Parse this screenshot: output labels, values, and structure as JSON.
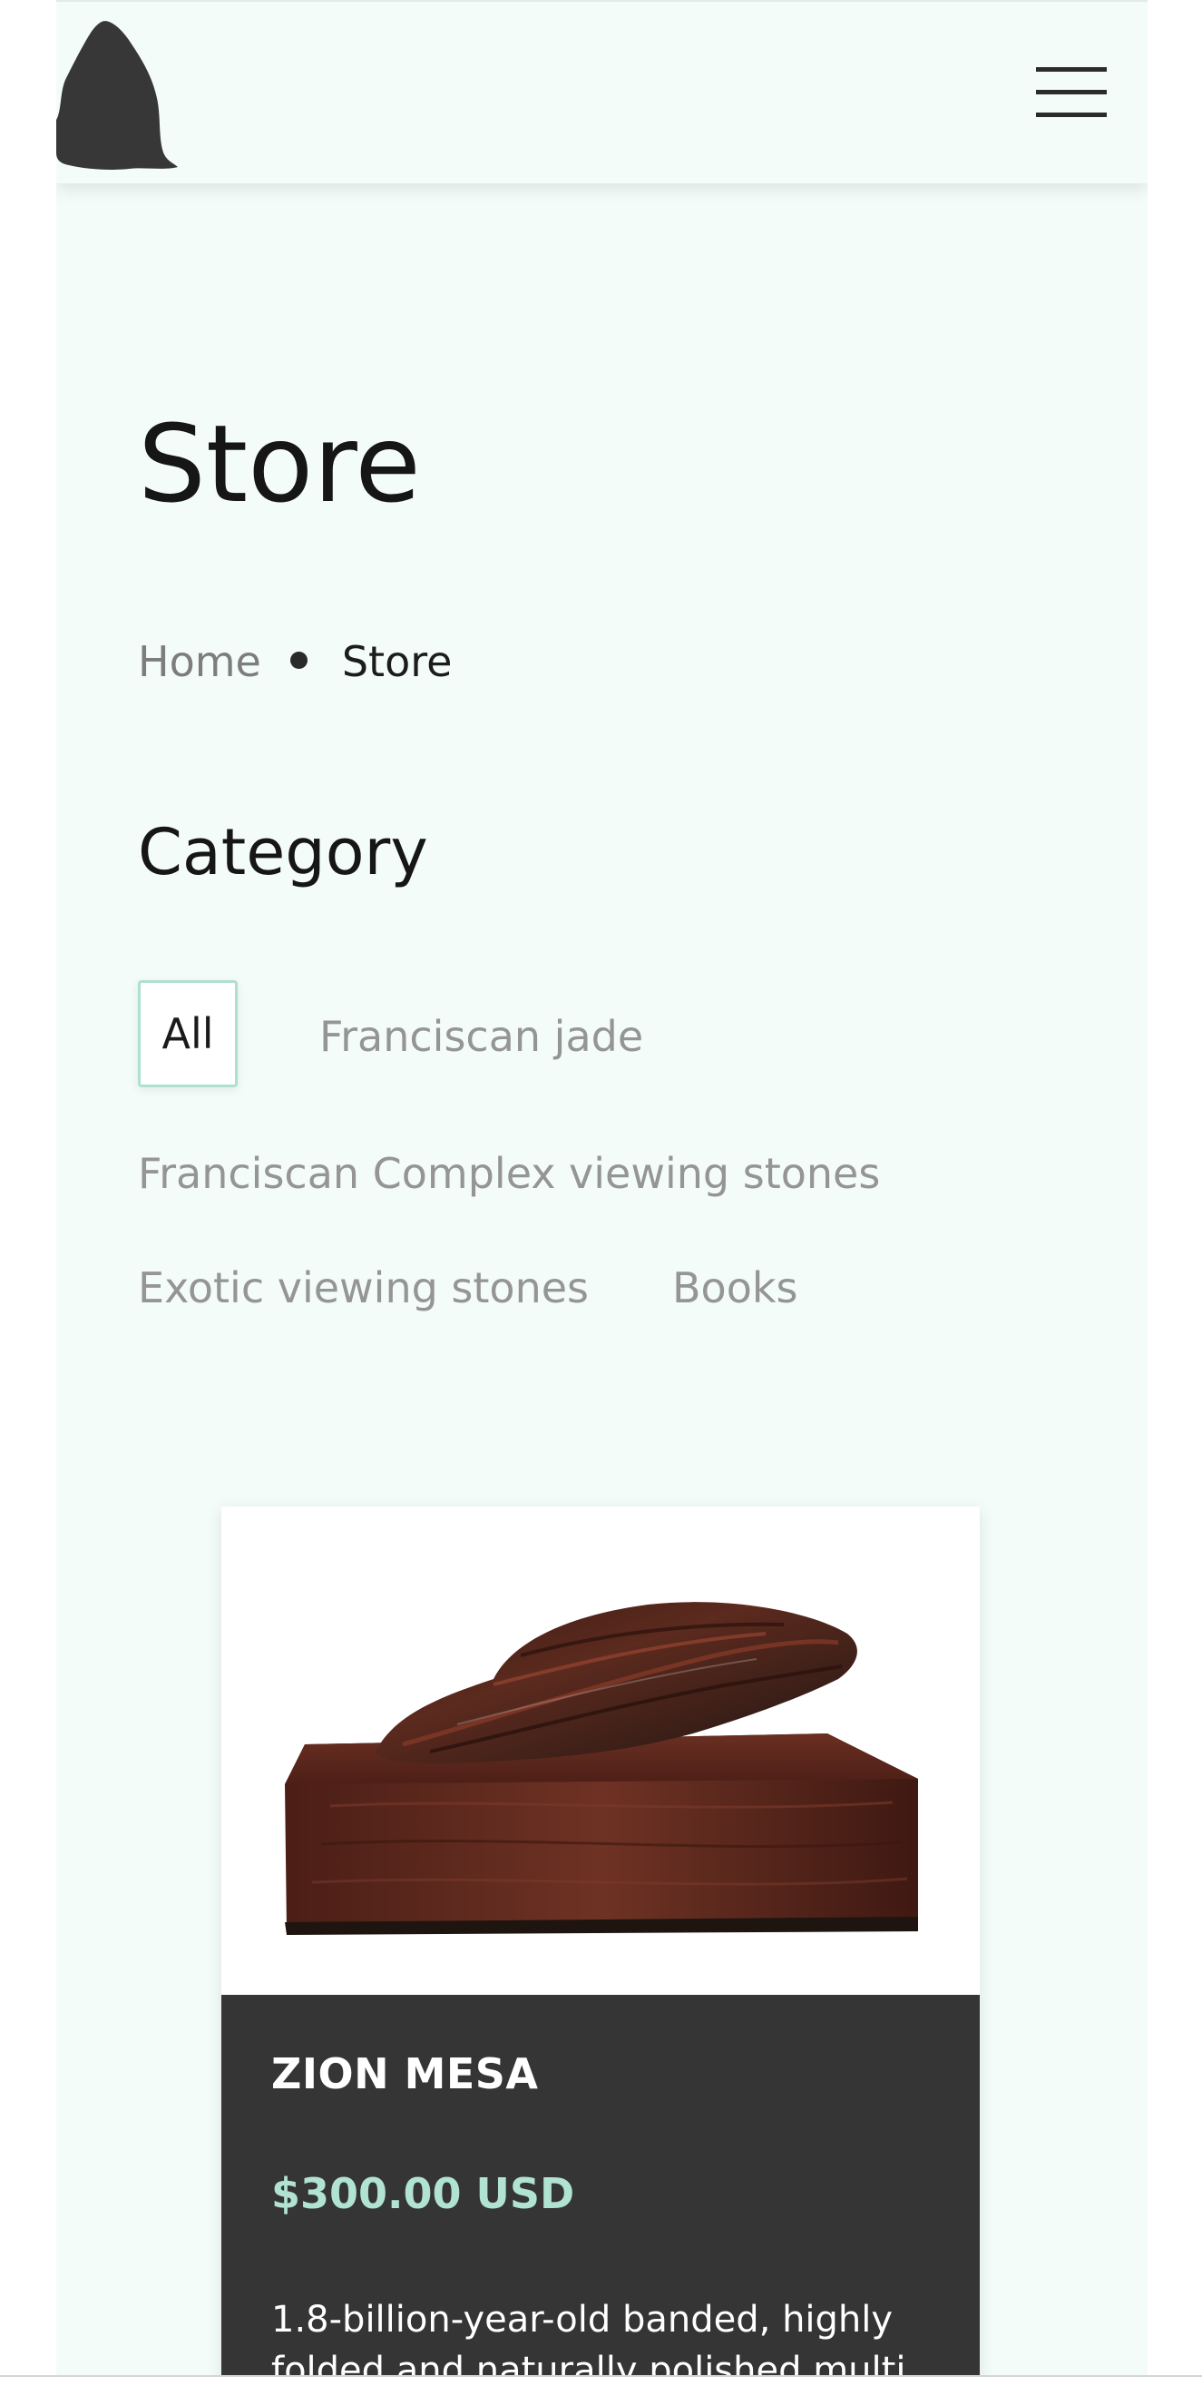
{
  "header": {
    "logo_icon": "stone-silhouette-logo",
    "menu_icon": "hamburger-menu-icon"
  },
  "page": {
    "title": "Store"
  },
  "breadcrumb": {
    "home": "Home",
    "current": "Store"
  },
  "categories": {
    "heading": "Category",
    "items": [
      {
        "label": "All",
        "active": true
      },
      {
        "label": "Franciscan jade",
        "active": false
      },
      {
        "label": "Franciscan Complex viewing stones",
        "active": false
      },
      {
        "label": "Exotic viewing stones",
        "active": false
      },
      {
        "label": "Books",
        "active": false
      }
    ]
  },
  "product": {
    "name": "ZION MESA",
    "price": "$300.00 USD",
    "description": "1.8-billion-year-old banded, highly folded and naturally polished multi"
  },
  "colors": {
    "page_background": "#f3fcf9",
    "card_info_background": "#353535",
    "price_accent": "#b1e3d2",
    "active_filter_border": "#aee0d2",
    "logo": "#373737"
  }
}
